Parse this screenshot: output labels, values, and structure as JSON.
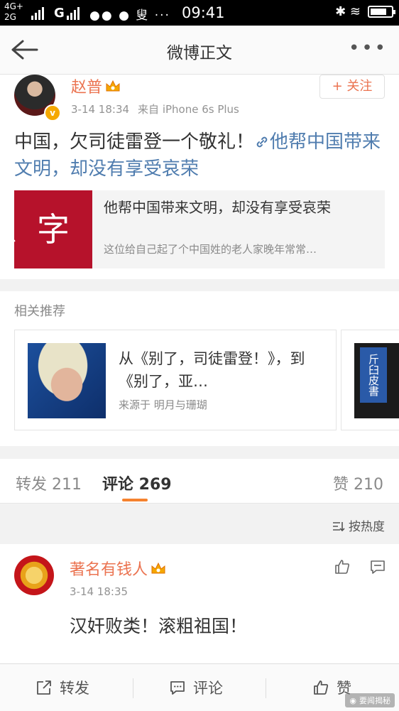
{
  "status_bar": {
    "network_top": "4G+",
    "network_bottom": "2G",
    "carrier": "G",
    "app_icons": "●● ● 叟 ···",
    "time": "09:41",
    "right_icons": "✱ ≋"
  },
  "nav": {
    "title": "微博正文",
    "more": "•••"
  },
  "post": {
    "author": "赵普",
    "time": "3-14 18:34",
    "source": "来自 iPhone 6s Plus",
    "follow_label": "+ 关注",
    "text_prefix": "中国，欠司徒雷登一个敬礼！",
    "text_link": "他帮中国带来文明，却没有享受哀荣",
    "link_card": {
      "thumb_text": "、字",
      "title": "他帮中国带来文明，却没有享受哀荣",
      "description": "这位给自己起了个中国姓的老人家晚年常常…"
    }
  },
  "related": {
    "heading": "相关推荐",
    "items": [
      {
        "title": "从《别了，司徒雷登！》，到《别了，亚…",
        "source": "来源于  明月与珊瑚"
      },
      {
        "thumb_text": "斤臼皮書"
      }
    ]
  },
  "tabs": [
    {
      "label": "转发 211"
    },
    {
      "label": "评论 269"
    },
    {
      "label": "赞 210"
    }
  ],
  "sort_label": "按热度",
  "comment": {
    "author": "著名有钱人",
    "time": "3-14 18:35",
    "text": "汉奸败类！滚粗祖国！"
  },
  "toolbar": {
    "repost": "转发",
    "comment": "评论",
    "like": "赞"
  },
  "watermark": "要闻揭秘",
  "colors": {
    "name_orange": "#eb7350",
    "link_blue": "#507daf",
    "tab_indicator": "#f5822e"
  }
}
